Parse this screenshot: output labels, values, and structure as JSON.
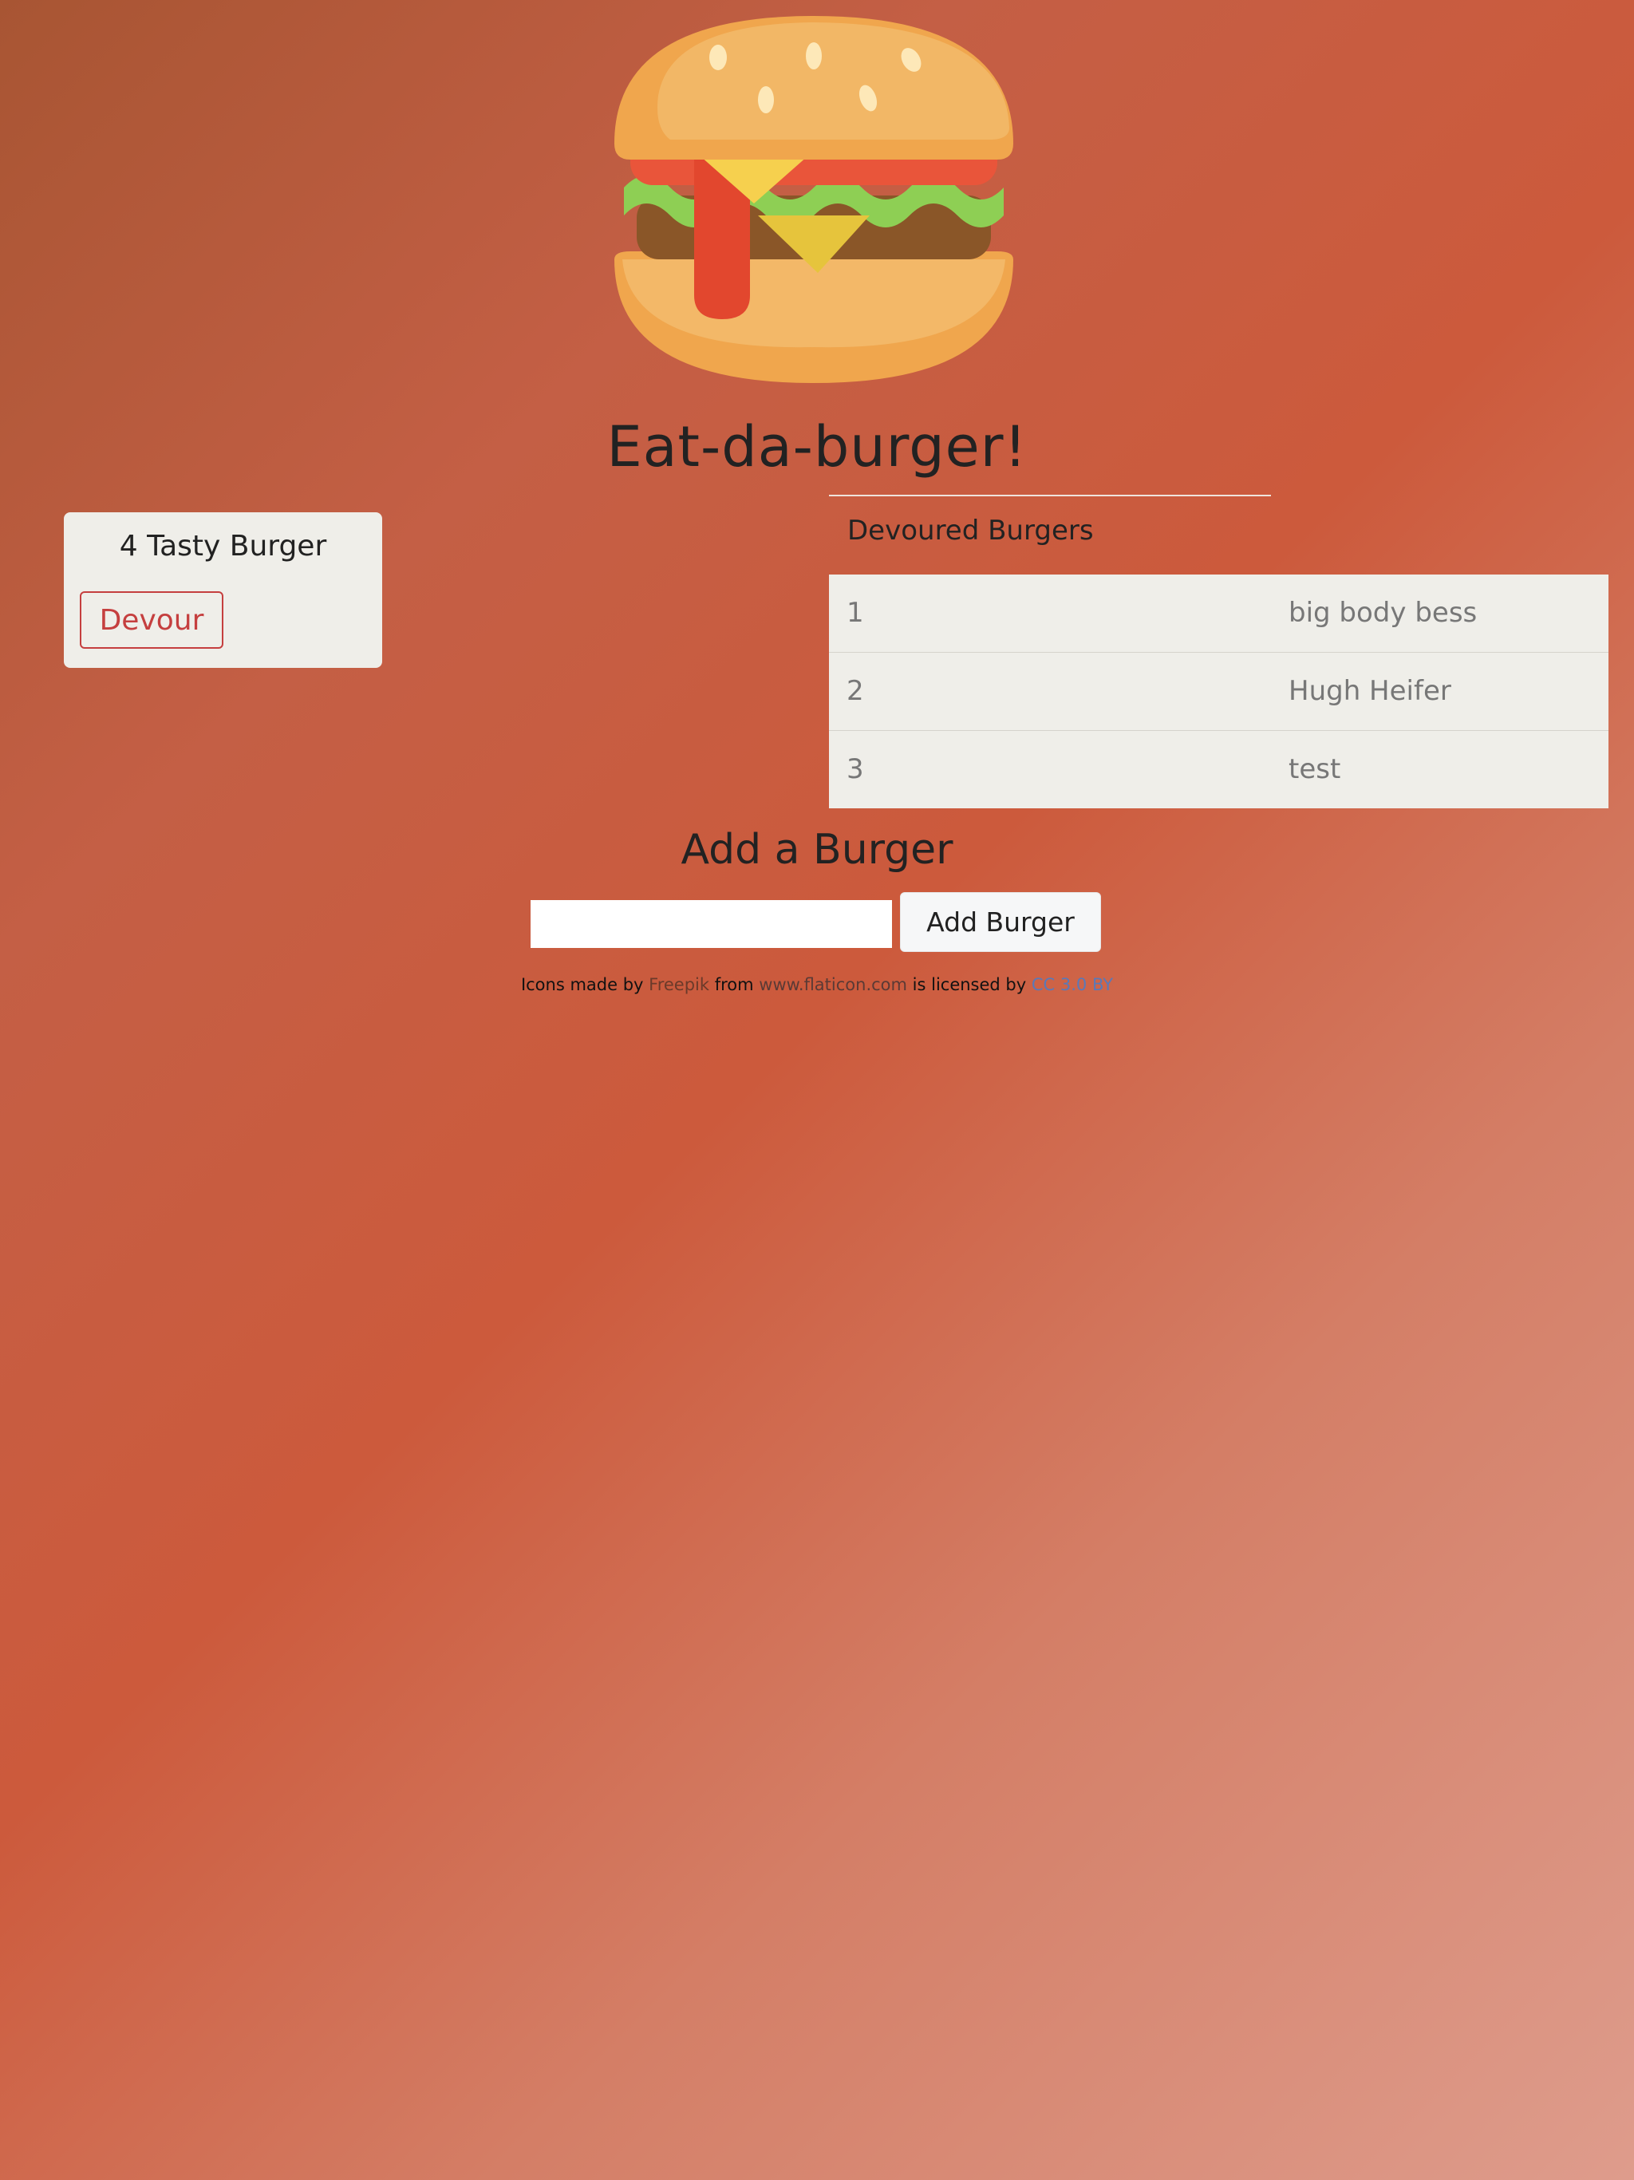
{
  "header": {
    "logo_icon": "burger-icon",
    "title": "Eat-da-burger!"
  },
  "uneaten": {
    "burgers": [
      {
        "name": "4 Tasty Burger",
        "button_label": "Devour"
      }
    ]
  },
  "devoured": {
    "heading": "Devoured Burgers",
    "rows": [
      {
        "id": "1",
        "name": "big body bess"
      },
      {
        "id": "2",
        "name": "Hugh Heifer"
      },
      {
        "id": "3",
        "name": "test"
      }
    ]
  },
  "add_form": {
    "heading": "Add a Burger",
    "input_value": "",
    "button_label": "Add Burger"
  },
  "credit": {
    "prefix": "Icons made by",
    "author": "Freepik",
    "from": "from",
    "site": "www.flaticon.com",
    "licensed": "is licensed by",
    "license": "CC 3.0 BY"
  },
  "colors": {
    "accent_red": "#c53f3f",
    "card_bg": "#efeee9",
    "license_link": "#5a79b8"
  }
}
